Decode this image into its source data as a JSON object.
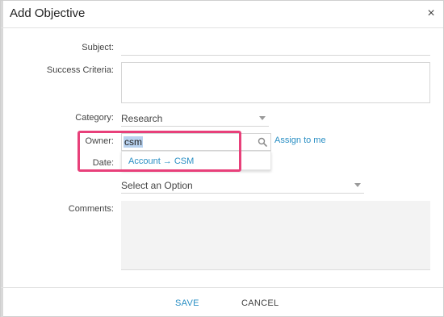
{
  "dialog": {
    "title": "Add Objective",
    "close_glyph": "×"
  },
  "form": {
    "subject_label": "Subject:",
    "success_criteria_label": "Success Criteria:",
    "category_label": "Category:",
    "category_value": "Research",
    "owner_label": "Owner:",
    "owner_value": "csm",
    "assign_to_me": "Assign to me",
    "owner_suggestion": "Account → CSM",
    "date_label": "Date:",
    "select_placeholder": "Select an Option",
    "comments_label": "Comments:"
  },
  "footer": {
    "save_label": "SAVE",
    "cancel_label": "CANCEL"
  },
  "colors": {
    "accent": "#2a8fc4",
    "highlight": "#e8407a"
  },
  "icons": {
    "close": "close-icon",
    "search": "search-icon",
    "caret": "chevron-down-icon"
  }
}
